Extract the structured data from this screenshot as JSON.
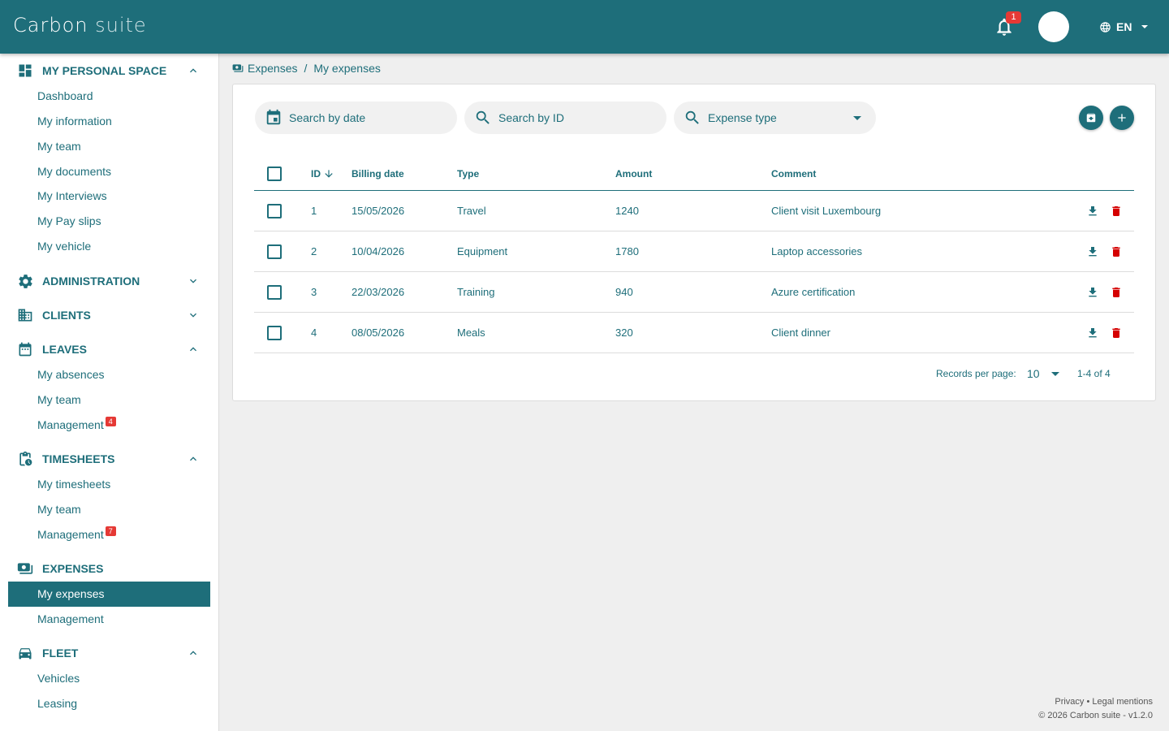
{
  "app": {
    "brand_main": "Carbon",
    "brand_sub": "suite"
  },
  "header": {
    "notification_count": "1",
    "language": "EN"
  },
  "sidebar": {
    "personal_space": {
      "title": "MY PERSONAL SPACE",
      "items": [
        "Dashboard",
        "My information",
        "My team",
        "My documents",
        "My Interviews",
        "My Pay slips",
        "My vehicle"
      ]
    },
    "administration": {
      "title": "ADMINISTRATION"
    },
    "clients": {
      "title": "CLIENTS"
    },
    "leaves": {
      "title": "LEAVES",
      "items": [
        "My absences",
        "My team",
        "Management"
      ],
      "management_badge": "4"
    },
    "timesheets": {
      "title": "TIMESHEETS",
      "items": [
        "My timesheets",
        "My team",
        "Management"
      ],
      "management_badge": "7"
    },
    "expenses": {
      "title": "EXPENSES",
      "items": [
        "My expenses",
        "Management"
      ]
    },
    "fleet": {
      "title": "FLEET",
      "items": [
        "Vehicles",
        "Leasing"
      ]
    }
  },
  "breadcrumb": {
    "parent": "Expenses",
    "separator": "/",
    "current": "My expenses"
  },
  "filters": {
    "date_placeholder": "Search by date",
    "id_placeholder": "Search by ID",
    "type_label": "Expense type"
  },
  "table": {
    "columns": {
      "id": "ID",
      "billing_date": "Billing date",
      "type": "Type",
      "amount": "Amount",
      "comment": "Comment"
    },
    "rows": [
      {
        "id": "1",
        "billing_date": "15/05/2026",
        "type": "Travel",
        "amount": "1240",
        "comment": "Client visit Luxembourg"
      },
      {
        "id": "2",
        "billing_date": "10/04/2026",
        "type": "Equipment",
        "amount": "1780",
        "comment": "Laptop accessories"
      },
      {
        "id": "3",
        "billing_date": "22/03/2026",
        "type": "Training",
        "amount": "940",
        "comment": "Azure certification"
      },
      {
        "id": "4",
        "billing_date": "08/05/2026",
        "type": "Meals",
        "amount": "320",
        "comment": "Client dinner"
      }
    ]
  },
  "pagination": {
    "label": "Records per page:",
    "per_page": "10",
    "range": "1-4 of 4"
  },
  "footer": {
    "links": "Privacy • Legal mentions",
    "copyright": "© 2026 Carbon suite - v1.2.0"
  },
  "colors": {
    "primary": "#1e6e7a",
    "danger": "#d50000",
    "badge": "#e53935"
  }
}
